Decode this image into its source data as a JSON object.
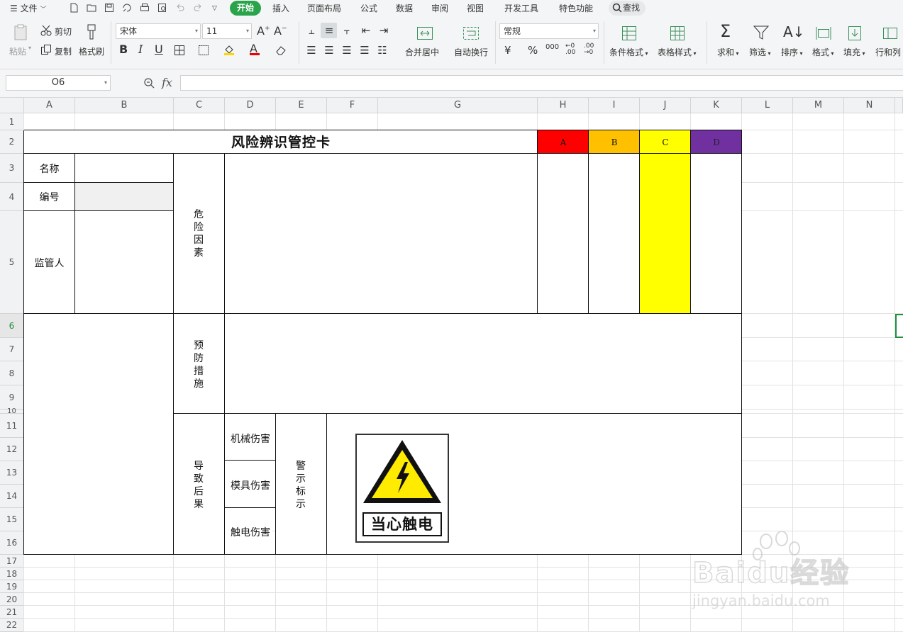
{
  "menubar": {
    "file": "文件",
    "tabs": [
      "开始",
      "插入",
      "页面布局",
      "公式",
      "数据",
      "审阅",
      "视图",
      "开发工具",
      "特色功能"
    ],
    "find": "查找"
  },
  "ribbon": {
    "paste": "粘贴",
    "cut": "剪切",
    "copy": "复制",
    "format_painter": "格式刷",
    "font_name": "宋体",
    "font_size": "11",
    "bold": "B",
    "italic": "I",
    "underline": "U",
    "merge_center": "合并居中",
    "wrap_text": "自动换行",
    "number_format": "常规",
    "currency": "¥",
    "percent": "%",
    "thousands": "000",
    "cond_format": "条件格式",
    "table_style": "表格样式",
    "sum": "求和",
    "filter": "筛选",
    "sort": "排序",
    "format": "格式",
    "fill": "填充",
    "row_col": "行和列"
  },
  "formula_bar": {
    "name_box": "O6",
    "fx": "fx",
    "content": ""
  },
  "grid": {
    "columns": [
      "A",
      "B",
      "C",
      "D",
      "E",
      "F",
      "G",
      "H",
      "I",
      "J",
      "K",
      "L",
      "M",
      "N"
    ],
    "rows": [
      "1",
      "2",
      "3",
      "4",
      "5",
      "6",
      "7",
      "8",
      "9",
      "10",
      "11",
      "12",
      "13",
      "14",
      "15",
      "16",
      "17",
      "18",
      "19",
      "20",
      "21",
      "22"
    ],
    "active_row": "6"
  },
  "sheet": {
    "title": "风险辨识管控卡",
    "name_label": "名称",
    "number_label": "编号",
    "supervisor_label": "监管人",
    "hazard_label": "危险因素",
    "prevention_label": "预防措施",
    "consequence_label": "导致后果",
    "consequences": [
      "机械伤害",
      "模具伤害",
      "触电伤害"
    ],
    "warning_label": "警示标示",
    "risk_levels": [
      {
        "label": "A",
        "color": "#ff0000"
      },
      {
        "label": "B",
        "color": "#ffc000"
      },
      {
        "label": "C",
        "color": "#ffff00"
      },
      {
        "label": "D",
        "color": "#7030a0"
      }
    ],
    "warning_sign_text": "当心触电"
  },
  "watermark": {
    "brand": "Baidu经验",
    "url": "jingyan.baidu.com"
  }
}
